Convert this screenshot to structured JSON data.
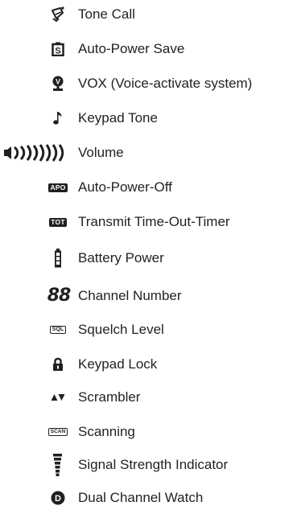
{
  "legend": {
    "items": [
      {
        "icon": "bell-icon",
        "label": "Tone Call"
      },
      {
        "icon": "power-save-icon",
        "label": "Auto-Power Save"
      },
      {
        "icon": "vox-microphone-icon",
        "label": "VOX (Voice-activate system)"
      },
      {
        "icon": "music-note-icon",
        "label": "Keypad Tone"
      },
      {
        "icon": "volume-bars-icon",
        "label": "Volume"
      },
      {
        "icon": "apo-badge-icon",
        "label": "Auto-Power-Off",
        "badge_text": "APO"
      },
      {
        "icon": "tot-badge-icon",
        "label": "Transmit Time-Out-Timer",
        "badge_text": "TOT"
      },
      {
        "icon": "battery-icon",
        "label": "Battery Power"
      },
      {
        "icon": "seven-segment-icon",
        "label": "Channel Number",
        "badge_text": "88"
      },
      {
        "icon": "sql-badge-icon",
        "label": "Squelch Level",
        "badge_text": "SQL"
      },
      {
        "icon": "padlock-icon",
        "label": "Keypad Lock"
      },
      {
        "icon": "scrambler-arrows-icon",
        "label": "Scrambler"
      },
      {
        "icon": "scan-badge-icon",
        "label": "Scanning",
        "badge_text": "SCAN"
      },
      {
        "icon": "signal-strength-icon",
        "label": "Signal Strength Indicator"
      },
      {
        "icon": "dual-watch-icon",
        "label": "Dual Channel Watch",
        "badge_text": "D"
      }
    ]
  }
}
